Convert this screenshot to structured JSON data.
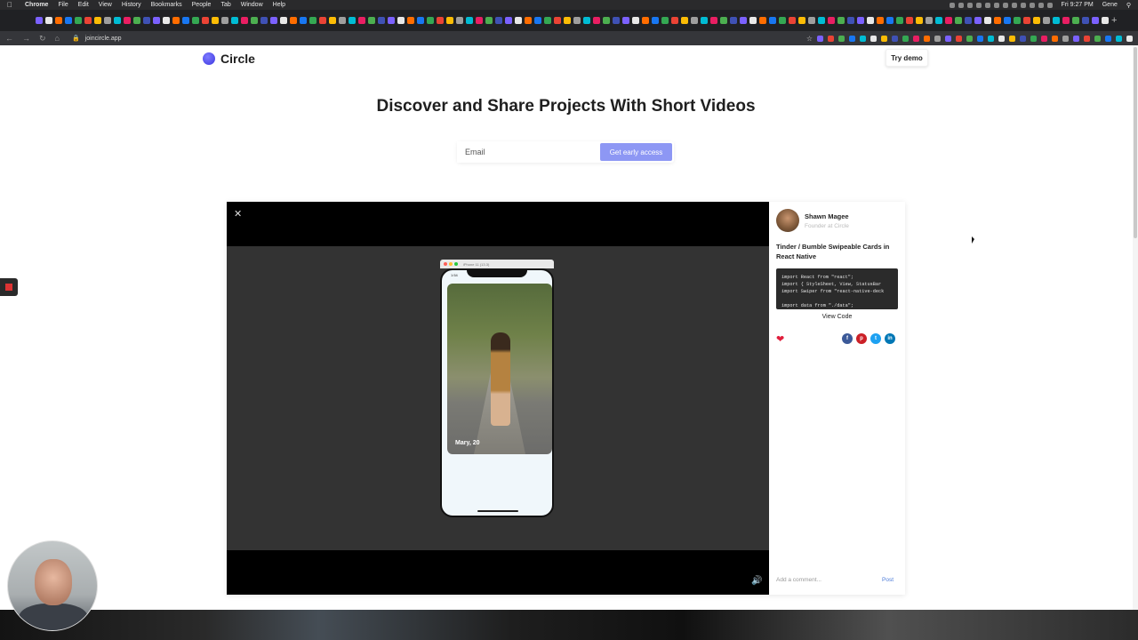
{
  "menubar": {
    "items": [
      "Chrome",
      "File",
      "Edit",
      "View",
      "History",
      "Bookmarks",
      "People",
      "Tab",
      "Window",
      "Help"
    ],
    "clock": "Fri 9:27 PM",
    "user": "Gene"
  },
  "browser": {
    "url": "joincircle.app"
  },
  "site": {
    "brand": "Circle",
    "try_demo": "Try demo",
    "headline": "Discover and Share Projects With Short Videos",
    "email_placeholder": "Email",
    "cta": "Get early access"
  },
  "video": {
    "simulator_title": "iPhone 11 (13.3)",
    "phone_time": "1:54",
    "card_label": "Mary, 20"
  },
  "panel": {
    "author_name": "Shawn Magee",
    "author_role": "Founder at Circle",
    "project_title": "Tinder / Bumble Swipeable Cards in React Native",
    "code_lines": [
      "import React from \"react\";",
      "import { StyleSheet, View, StatusBar",
      "import Swiper from \"react-native-deck",
      "",
      "import data from \"./data\";"
    ],
    "view_code": "View Code",
    "comment_placeholder": "Add a comment...",
    "post": "Post"
  },
  "colors": {
    "accent": "#8d97f4",
    "brand": "#4a44e6",
    "like": "#e01e3c",
    "facebook": "#3b5998",
    "pinterest": "#cb2027",
    "twitter": "#1da1f2",
    "linkedin": "#0077b5"
  }
}
